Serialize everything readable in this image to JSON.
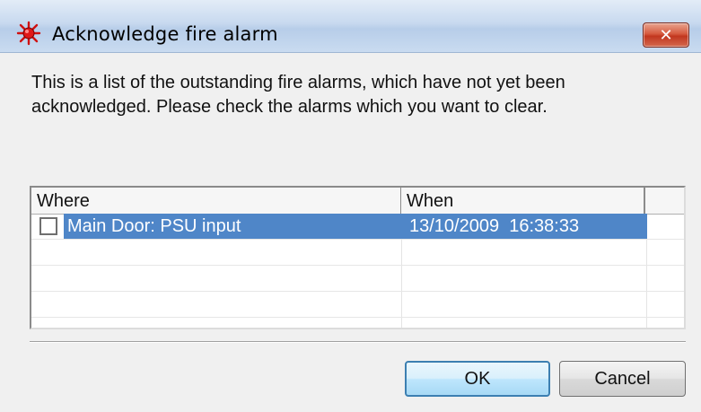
{
  "window": {
    "title": "Acknowledge fire alarm",
    "close_label": "✕",
    "title_icon": "fire-alarm-icon"
  },
  "description": "This is a list of the outstanding fire alarms, which have not yet been acknowledged. Please check the alarms which you want to clear.",
  "alarm_list": {
    "columns": [
      "Where",
      "When",
      ""
    ],
    "rows": [
      {
        "checked": false,
        "where": "Main Door: PSU input",
        "when": "13/10/2009  16:38:33",
        "selected": true
      }
    ]
  },
  "buttons": {
    "ok": "OK",
    "cancel": "Cancel"
  },
  "colors": {
    "selection": "#4f86c8",
    "ok_border": "#3c7fb1",
    "close_red": "#c1371f"
  }
}
